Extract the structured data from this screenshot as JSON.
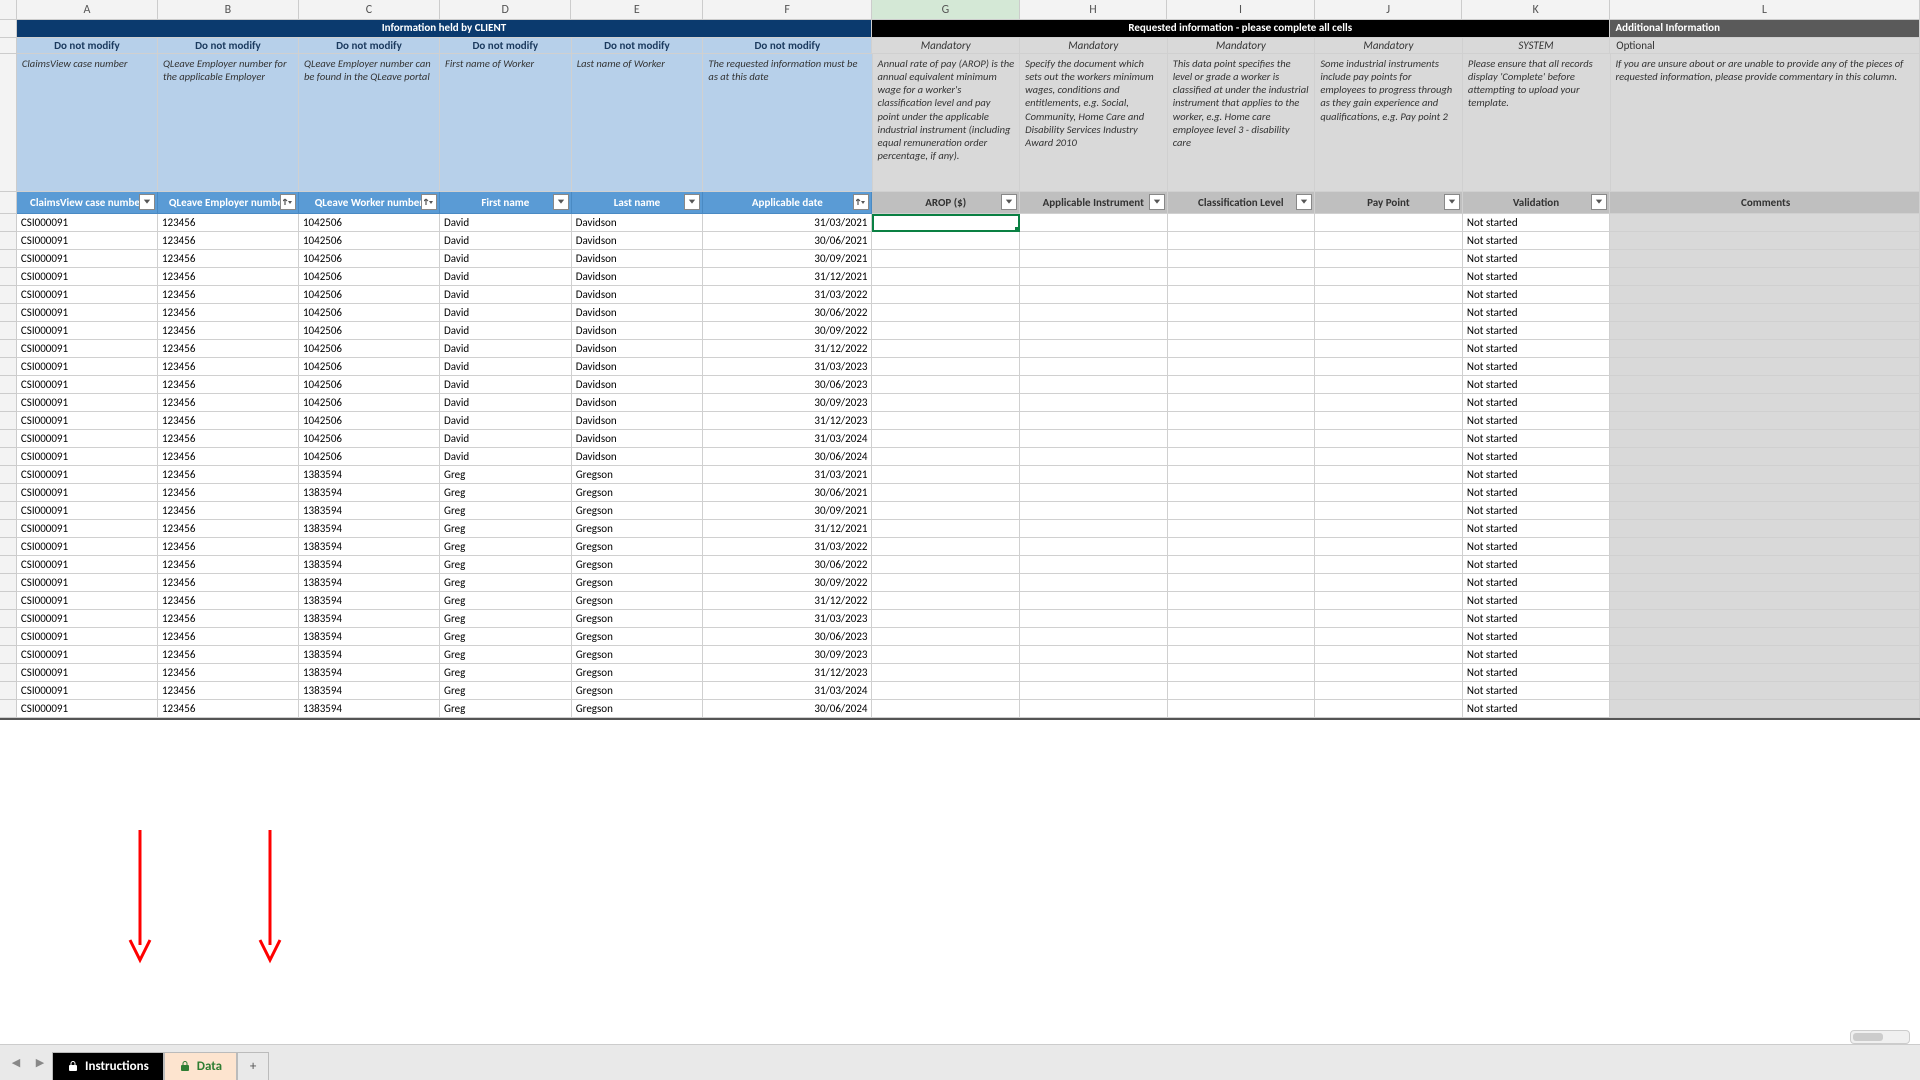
{
  "columns": [
    "A",
    "B",
    "C",
    "D",
    "E",
    "F",
    "G",
    "H",
    "I",
    "J",
    "K",
    "L"
  ],
  "sections": {
    "client": "Information held by CLIENT",
    "requested": "Requested information - please complete all cells",
    "additional": "Additional Information"
  },
  "sub1": {
    "A": "Do not modify",
    "B": "Do not modify",
    "C": "Do not modify",
    "D": "Do not modify",
    "E": "Do not modify",
    "F": "Do not modify",
    "G": "Mandatory",
    "H": "Mandatory",
    "I": "Mandatory",
    "J": "Mandatory",
    "K": "SYSTEM",
    "L": "Optional"
  },
  "desc": {
    "A": "ClaimsView case number",
    "B": "QLeave Employer number for the applicable Employer",
    "C": "QLeave Employer number can be found in the QLeave portal",
    "D": "First name of Worker",
    "E": "Last name of Worker",
    "F": "The requested information must be as at this date",
    "G": "Annual rate of pay (AROP) is the annual equivalent minimum wage for a worker's classification level and pay point under the applicable industrial instrument (including equal remuneration order percentage, if any).",
    "H": "Specify the document which sets out the workers minimum wages, conditions and entitlements, e.g. Social, Community, Home Care and Disability Services Industry Award 2010",
    "I": "This data point specifies the level or grade a worker is classified at under the industrial instrument that applies to the worker, e.g. Home care employee level 3 - disability care",
    "J": "Some industrial instruments include pay points for employees to progress through as they gain experience and qualifications, e.g. Pay point 2",
    "K": "Please ensure that all records display 'Complete' before attempting to upload your template.",
    "L": "If you are unsure about or are unable to provide any of the pieces of requested information, please provide commentary in this column."
  },
  "headers": {
    "A": "ClaimsView case number",
    "B": "QLeave Employer number",
    "C": "QLeave Worker number",
    "D": "First name",
    "E": "Last name",
    "F": "Applicable date",
    "G": "AROP ($)",
    "H": "Applicable Instrument",
    "I": "Classification Level",
    "J": "Pay Point",
    "K": "Validation",
    "L": "Comments"
  },
  "rows": [
    {
      "a": "CSI000091",
      "b": "123456",
      "c": "1042506",
      "d": "David",
      "e": "Davidson",
      "f": "31/03/2021",
      "k": "Not started"
    },
    {
      "a": "CSI000091",
      "b": "123456",
      "c": "1042506",
      "d": "David",
      "e": "Davidson",
      "f": "30/06/2021",
      "k": "Not started"
    },
    {
      "a": "CSI000091",
      "b": "123456",
      "c": "1042506",
      "d": "David",
      "e": "Davidson",
      "f": "30/09/2021",
      "k": "Not started"
    },
    {
      "a": "CSI000091",
      "b": "123456",
      "c": "1042506",
      "d": "David",
      "e": "Davidson",
      "f": "31/12/2021",
      "k": "Not started"
    },
    {
      "a": "CSI000091",
      "b": "123456",
      "c": "1042506",
      "d": "David",
      "e": "Davidson",
      "f": "31/03/2022",
      "k": "Not started"
    },
    {
      "a": "CSI000091",
      "b": "123456",
      "c": "1042506",
      "d": "David",
      "e": "Davidson",
      "f": "30/06/2022",
      "k": "Not started"
    },
    {
      "a": "CSI000091",
      "b": "123456",
      "c": "1042506",
      "d": "David",
      "e": "Davidson",
      "f": "30/09/2022",
      "k": "Not started"
    },
    {
      "a": "CSI000091",
      "b": "123456",
      "c": "1042506",
      "d": "David",
      "e": "Davidson",
      "f": "31/12/2022",
      "k": "Not started"
    },
    {
      "a": "CSI000091",
      "b": "123456",
      "c": "1042506",
      "d": "David",
      "e": "Davidson",
      "f": "31/03/2023",
      "k": "Not started"
    },
    {
      "a": "CSI000091",
      "b": "123456",
      "c": "1042506",
      "d": "David",
      "e": "Davidson",
      "f": "30/06/2023",
      "k": "Not started"
    },
    {
      "a": "CSI000091",
      "b": "123456",
      "c": "1042506",
      "d": "David",
      "e": "Davidson",
      "f": "30/09/2023",
      "k": "Not started"
    },
    {
      "a": "CSI000091",
      "b": "123456",
      "c": "1042506",
      "d": "David",
      "e": "Davidson",
      "f": "31/12/2023",
      "k": "Not started"
    },
    {
      "a": "CSI000091",
      "b": "123456",
      "c": "1042506",
      "d": "David",
      "e": "Davidson",
      "f": "31/03/2024",
      "k": "Not started"
    },
    {
      "a": "CSI000091",
      "b": "123456",
      "c": "1042506",
      "d": "David",
      "e": "Davidson",
      "f": "30/06/2024",
      "k": "Not started"
    },
    {
      "a": "CSI000091",
      "b": "123456",
      "c": "1383594",
      "d": "Greg",
      "e": "Gregson",
      "f": "31/03/2021",
      "k": "Not started"
    },
    {
      "a": "CSI000091",
      "b": "123456",
      "c": "1383594",
      "d": "Greg",
      "e": "Gregson",
      "f": "30/06/2021",
      "k": "Not started"
    },
    {
      "a": "CSI000091",
      "b": "123456",
      "c": "1383594",
      "d": "Greg",
      "e": "Gregson",
      "f": "30/09/2021",
      "k": "Not started"
    },
    {
      "a": "CSI000091",
      "b": "123456",
      "c": "1383594",
      "d": "Greg",
      "e": "Gregson",
      "f": "31/12/2021",
      "k": "Not started"
    },
    {
      "a": "CSI000091",
      "b": "123456",
      "c": "1383594",
      "d": "Greg",
      "e": "Gregson",
      "f": "31/03/2022",
      "k": "Not started"
    },
    {
      "a": "CSI000091",
      "b": "123456",
      "c": "1383594",
      "d": "Greg",
      "e": "Gregson",
      "f": "30/06/2022",
      "k": "Not started"
    },
    {
      "a": "CSI000091",
      "b": "123456",
      "c": "1383594",
      "d": "Greg",
      "e": "Gregson",
      "f": "30/09/2022",
      "k": "Not started"
    },
    {
      "a": "CSI000091",
      "b": "123456",
      "c": "1383594",
      "d": "Greg",
      "e": "Gregson",
      "f": "31/12/2022",
      "k": "Not started"
    },
    {
      "a": "CSI000091",
      "b": "123456",
      "c": "1383594",
      "d": "Greg",
      "e": "Gregson",
      "f": "31/03/2023",
      "k": "Not started"
    },
    {
      "a": "CSI000091",
      "b": "123456",
      "c": "1383594",
      "d": "Greg",
      "e": "Gregson",
      "f": "30/06/2023",
      "k": "Not started"
    },
    {
      "a": "CSI000091",
      "b": "123456",
      "c": "1383594",
      "d": "Greg",
      "e": "Gregson",
      "f": "30/09/2023",
      "k": "Not started"
    },
    {
      "a": "CSI000091",
      "b": "123456",
      "c": "1383594",
      "d": "Greg",
      "e": "Gregson",
      "f": "31/12/2023",
      "k": "Not started"
    },
    {
      "a": "CSI000091",
      "b": "123456",
      "c": "1383594",
      "d": "Greg",
      "e": "Gregson",
      "f": "31/03/2024",
      "k": "Not started"
    },
    {
      "a": "CSI000091",
      "b": "123456",
      "c": "1383594",
      "d": "Greg",
      "e": "Gregson",
      "f": "30/06/2024",
      "k": "Not started"
    }
  ],
  "tabs": {
    "instructions": "Instructions",
    "data": "Data",
    "add": "+"
  }
}
